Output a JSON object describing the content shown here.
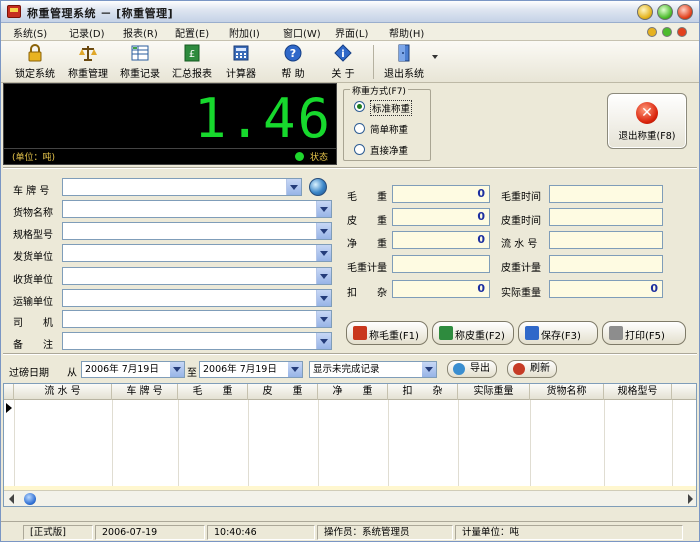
{
  "window": {
    "title": "称重管理系统 － [称重管理]"
  },
  "menu": [
    "系统(S)",
    "记录(D)",
    "报表(R)",
    "配置(E)",
    "附加(I)",
    "窗口(W)",
    "界面(L)",
    "帮助(H)"
  ],
  "toolbar": {
    "items": [
      {
        "label": "锁定系统",
        "icon": "lock-icon"
      },
      {
        "label": "称重管理",
        "icon": "scale-icon"
      },
      {
        "label": "称重记录",
        "icon": "records-icon"
      },
      {
        "label": "汇总报表",
        "icon": "report-icon"
      },
      {
        "label": "计算器",
        "icon": "calculator-icon"
      },
      {
        "label": "帮 助",
        "icon": "help-icon"
      },
      {
        "label": "关 于",
        "icon": "about-icon"
      },
      {
        "label": "退出系统",
        "icon": "exit-door-icon"
      }
    ]
  },
  "display": {
    "weight": "1.46",
    "unit": "(单位：吨)",
    "status": "状态",
    "status_color": "#1fd62d",
    "digit_color": "#17d92d"
  },
  "weigh_mode": {
    "legend": "称重方式(F7)",
    "options": [
      "标准称重",
      "简单称重",
      "直接净重"
    ],
    "selected": "标准称重"
  },
  "exit_weigh": {
    "label": "退出称重(F8)"
  },
  "form": {
    "fields": [
      {
        "label": "车 牌 号",
        "value": ""
      },
      {
        "label": "货物名称",
        "value": ""
      },
      {
        "label": "规格型号",
        "value": ""
      },
      {
        "label": "发货单位",
        "value": ""
      },
      {
        "label": "收货单位",
        "value": ""
      },
      {
        "label": "运输单位",
        "value": ""
      },
      {
        "label": "司　　机",
        "value": ""
      },
      {
        "label": "备　　注",
        "value": ""
      }
    ]
  },
  "weights": {
    "gross_label": "毛　　重",
    "gross_value": "0",
    "tare_label": "皮　　重",
    "tare_value": "0",
    "net_label": "净　　重",
    "net_value": "0",
    "gross_meter_label": "毛重计量",
    "gross_meter_value": "",
    "deduct_label": "扣　　杂",
    "deduct_value": "0",
    "gross_time_label": "毛重时间",
    "gross_time_value": "",
    "tare_time_label": "皮重时间",
    "tare_time_value": "",
    "serial_label": "流 水 号",
    "serial_value": "",
    "tare_meter_label": "皮重计量",
    "tare_meter_value": "",
    "actual_label": "实际重量",
    "actual_value": "0"
  },
  "actions": {
    "gross": "称毛重(F1)",
    "tare": "称皮重(F2)",
    "save": "保存(F3)",
    "print": "打印(F5)"
  },
  "filter": {
    "date_label": "过磅日期",
    "from": "从",
    "start_date": "2006年 7月19日",
    "to": "至",
    "end_date": "2006年 7月19日",
    "record_filter": "显示未完成记录",
    "export": "导出",
    "refresh": "刷新"
  },
  "table": {
    "columns": [
      "流 水 号",
      "车 牌 号",
      "毛　　重",
      "皮　　重",
      "净　　重",
      "扣　　杂",
      "实际重量",
      "货物名称",
      "规格型号"
    ],
    "rows": []
  },
  "statusbar": {
    "edition": "[正式版]",
    "date": "2006-07-19",
    "time": "10:40:46",
    "operator": "操作员：系统管理员",
    "unit": "计量单位：吨"
  }
}
